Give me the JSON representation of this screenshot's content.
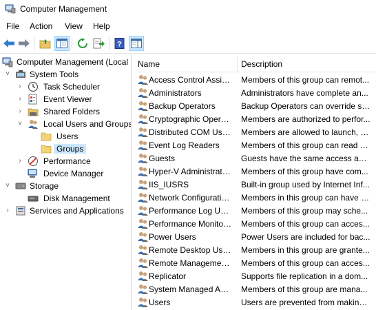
{
  "window": {
    "title": "Computer Management"
  },
  "menu": [
    "File",
    "Action",
    "View",
    "Help"
  ],
  "toolbar": {
    "buttons": [
      "back-arrow-icon",
      "forward-arrow-icon",
      "up-folder-icon",
      "show-hide-console-tree-icon",
      "refresh-icon",
      "export-list-icon",
      "help-icon",
      "show-hide-action-pane-icon"
    ]
  },
  "tree": {
    "items": [
      {
        "label": "Computer Management (Local",
        "expander": "",
        "icon": "computer-management-icon"
      },
      {
        "label": "System Tools",
        "expander": "˅",
        "icon": "system-tools-icon"
      },
      {
        "label": "Task Scheduler",
        "expander": "›",
        "icon": "task-scheduler-icon"
      },
      {
        "label": "Event Viewer",
        "expander": "›",
        "icon": "event-viewer-icon"
      },
      {
        "label": "Shared Folders",
        "expander": "›",
        "icon": "shared-folders-icon"
      },
      {
        "label": "Local Users and Groups",
        "expander": "˅",
        "icon": "local-users-groups-icon"
      },
      {
        "label": "Users",
        "expander": "",
        "icon": "folder-icon"
      },
      {
        "label": "Groups",
        "expander": "",
        "icon": "folder-icon"
      },
      {
        "label": "Performance",
        "expander": "›",
        "icon": "performance-icon"
      },
      {
        "label": "Device Manager",
        "expander": "",
        "icon": "device-manager-icon"
      },
      {
        "label": "Storage",
        "expander": "˅",
        "icon": "storage-icon"
      },
      {
        "label": "Disk Management",
        "expander": "",
        "icon": "disk-management-icon"
      },
      {
        "label": "Services and Applications",
        "expander": "›",
        "icon": "services-applications-icon"
      }
    ],
    "selected": "Groups"
  },
  "list": {
    "columns": [
      "Name",
      "Description"
    ],
    "rows": [
      {
        "name": "Access Control Assist...",
        "desc": "Members of this group can remot..."
      },
      {
        "name": "Administrators",
        "desc": "Administrators have complete an..."
      },
      {
        "name": "Backup Operators",
        "desc": "Backup Operators can override se..."
      },
      {
        "name": "Cryptographic Operat...",
        "desc": "Members are authorized to perfor..."
      },
      {
        "name": "Distributed COM Users",
        "desc": "Members are allowed to launch, a..."
      },
      {
        "name": "Event Log Readers",
        "desc": "Members of this group can read e..."
      },
      {
        "name": "Guests",
        "desc": "Guests have the same access as m..."
      },
      {
        "name": "Hyper-V Administrators",
        "desc": "Members of this group have com..."
      },
      {
        "name": "IIS_IUSRS",
        "desc": "Built-in group used by Internet Inf..."
      },
      {
        "name": "Network Configuratio...",
        "desc": "Members in this group can have s..."
      },
      {
        "name": "Performance Log Users",
        "desc": "Members of this group may sche..."
      },
      {
        "name": "Performance Monitor ...",
        "desc": "Members of this group can acces..."
      },
      {
        "name": "Power Users",
        "desc": "Power Users are included for bac..."
      },
      {
        "name": "Remote Desktop Users",
        "desc": "Members in this group are grante..."
      },
      {
        "name": "Remote Management...",
        "desc": "Members of this group can acces..."
      },
      {
        "name": "Replicator",
        "desc": "Supports file replication in a dom..."
      },
      {
        "name": "System Managed Acc...",
        "desc": "Members of this group are mana..."
      },
      {
        "name": "Users",
        "desc": "Users are prevented from making ..."
      }
    ]
  },
  "colors": {
    "selection": "#cce8ff",
    "selection_border": "#99d1ff",
    "divider": "#e5e5e5"
  }
}
